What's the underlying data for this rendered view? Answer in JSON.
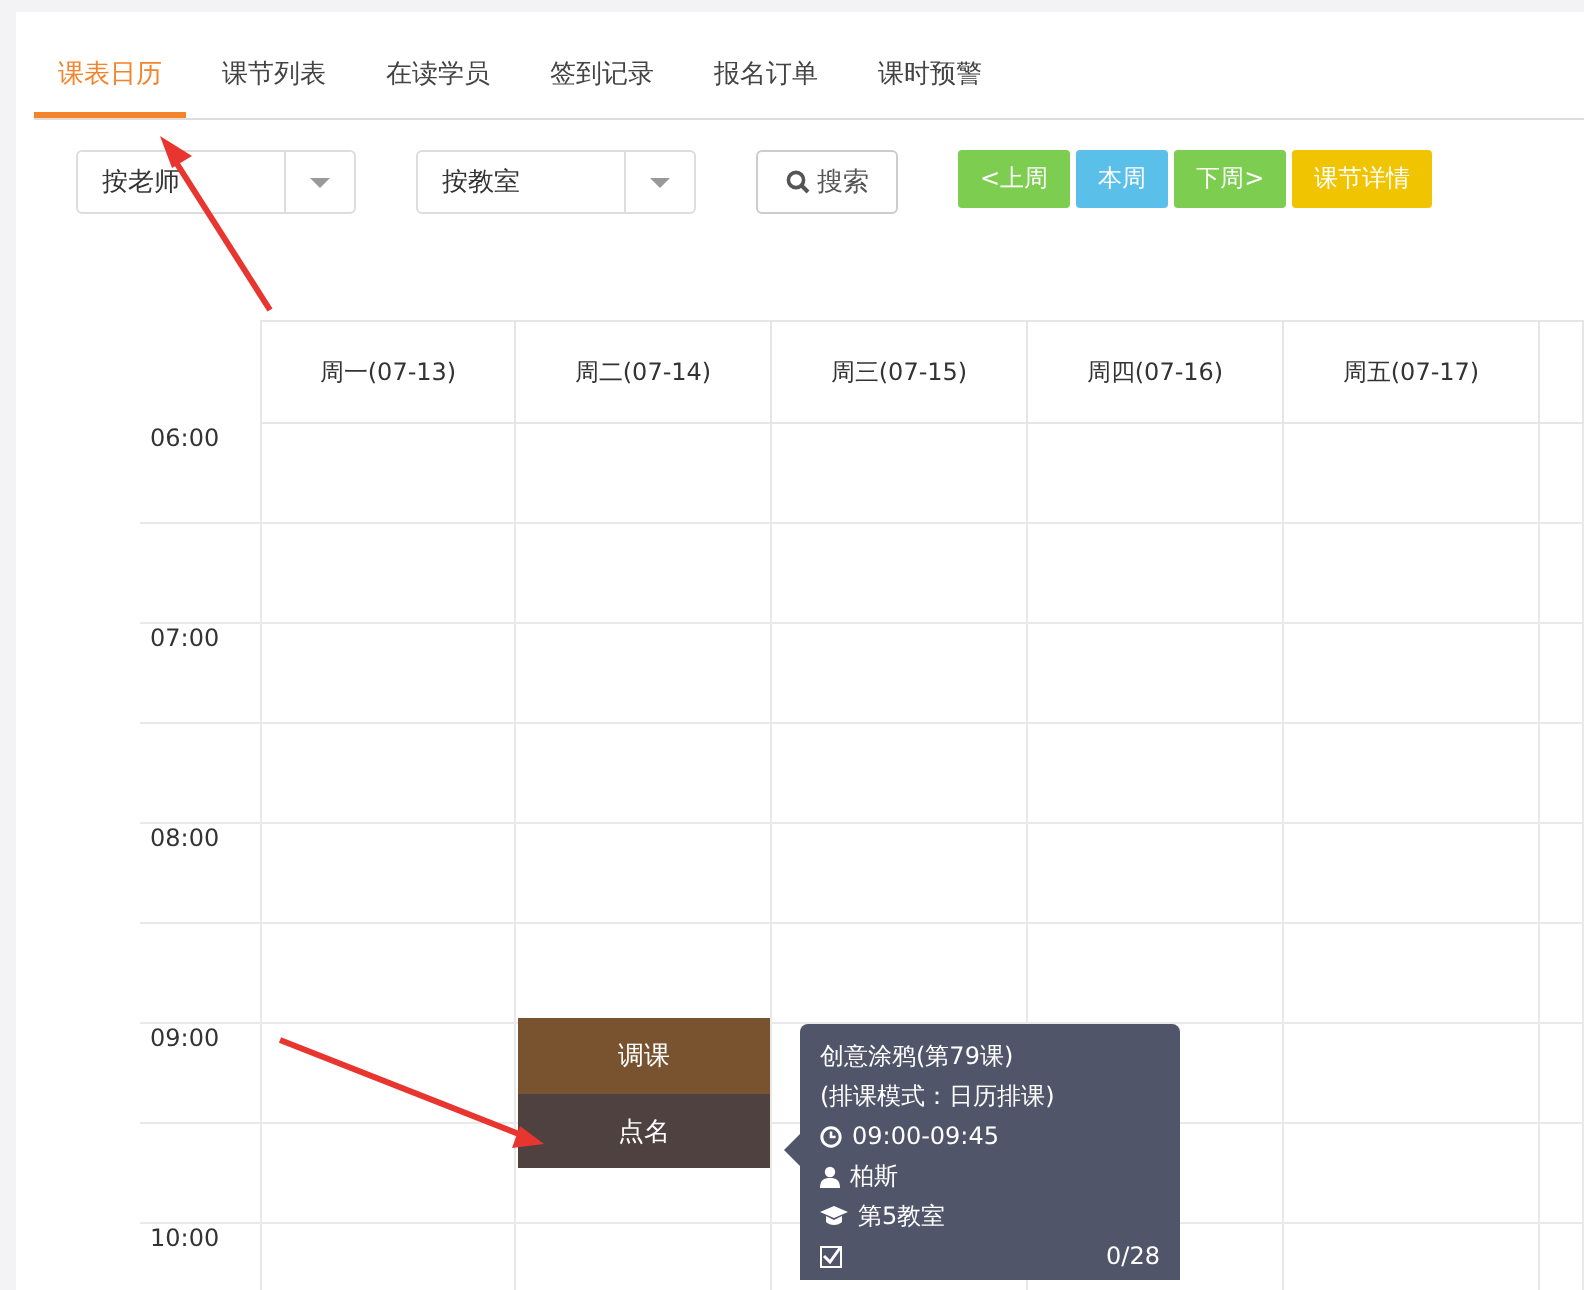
{
  "tabs": [
    {
      "label": "课表日历",
      "selected": true
    },
    {
      "label": "课节列表",
      "selected": false
    },
    {
      "label": "在读学员",
      "selected": false
    },
    {
      "label": "签到记录",
      "selected": false
    },
    {
      "label": "报名订单",
      "selected": false
    },
    {
      "label": "课时预警",
      "selected": false
    }
  ],
  "filters": [
    {
      "value": "按老师"
    },
    {
      "value": "按教室"
    }
  ],
  "search_button": "搜索",
  "week_buttons": [
    {
      "label": "<上周",
      "color": "#7ccd50"
    },
    {
      "label": "本周",
      "color": "#5bc0e9"
    },
    {
      "label": "下周>",
      "color": "#7ccd50"
    },
    {
      "label": "课节详情",
      "color": "#f0c400"
    }
  ],
  "days": [
    "周一(07-13)",
    "周二(07-14)",
    "周三(07-15)",
    "周四(07-16)",
    "周五(07-17)"
  ],
  "hours": [
    "06:00",
    "07:00",
    "08:00",
    "09:00",
    "10:00"
  ],
  "event": {
    "actions": [
      "调课",
      "点名"
    ]
  },
  "tooltip": {
    "title": "创意涂鸦(第79课)",
    "mode": "(排课模式：日历排课)",
    "time": "09:00-09:45",
    "teacher": "柏斯",
    "room": "第5教室",
    "count": "0/28"
  }
}
